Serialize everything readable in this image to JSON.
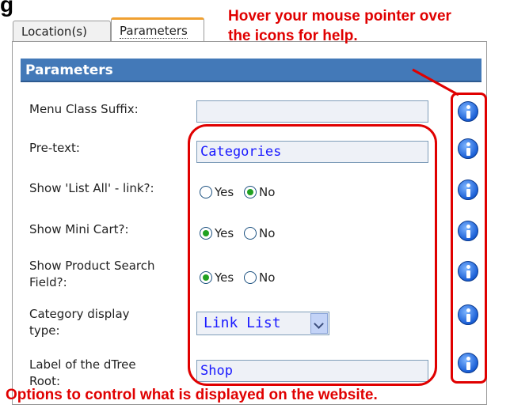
{
  "cutoff_text": "g",
  "tabs": [
    {
      "label": "Location(s)"
    },
    {
      "label": "Parameters"
    }
  ],
  "panel": {
    "title": "Parameters"
  },
  "fields": {
    "menu_class_suffix": {
      "label": "Menu Class Suffix:",
      "value": ""
    },
    "pre_text": {
      "label": "Pre-text:",
      "value": "Categories"
    },
    "show_list_all": {
      "label": "Show 'List All' - link?:",
      "yes": "Yes",
      "no": "No",
      "selected": "No"
    },
    "show_mini_cart": {
      "label": "Show Mini Cart?:",
      "yes": "Yes",
      "no": "No",
      "selected": "Yes"
    },
    "show_product_search": {
      "label_line1": "Show Product Search",
      "label_line2": "Field?:",
      "yes": "Yes",
      "no": "No",
      "selected": "Yes"
    },
    "category_display_type": {
      "label_line1": "Category display",
      "label_line2": "type:",
      "value": "Link List"
    },
    "dtree_root_label": {
      "label_line1": "Label of the dTree",
      "label_line2": "Root:",
      "value": "Shop"
    }
  },
  "annotations": {
    "hover_line1": "Hover your mouse pointer over",
    "hover_line2": "the icons for help.",
    "options_text": "Options to control what is displayed on the website."
  },
  "colors": {
    "header_bg": "#4379b8",
    "annotation_red": "#e00000",
    "active_tab_accent": "#f0a030"
  }
}
